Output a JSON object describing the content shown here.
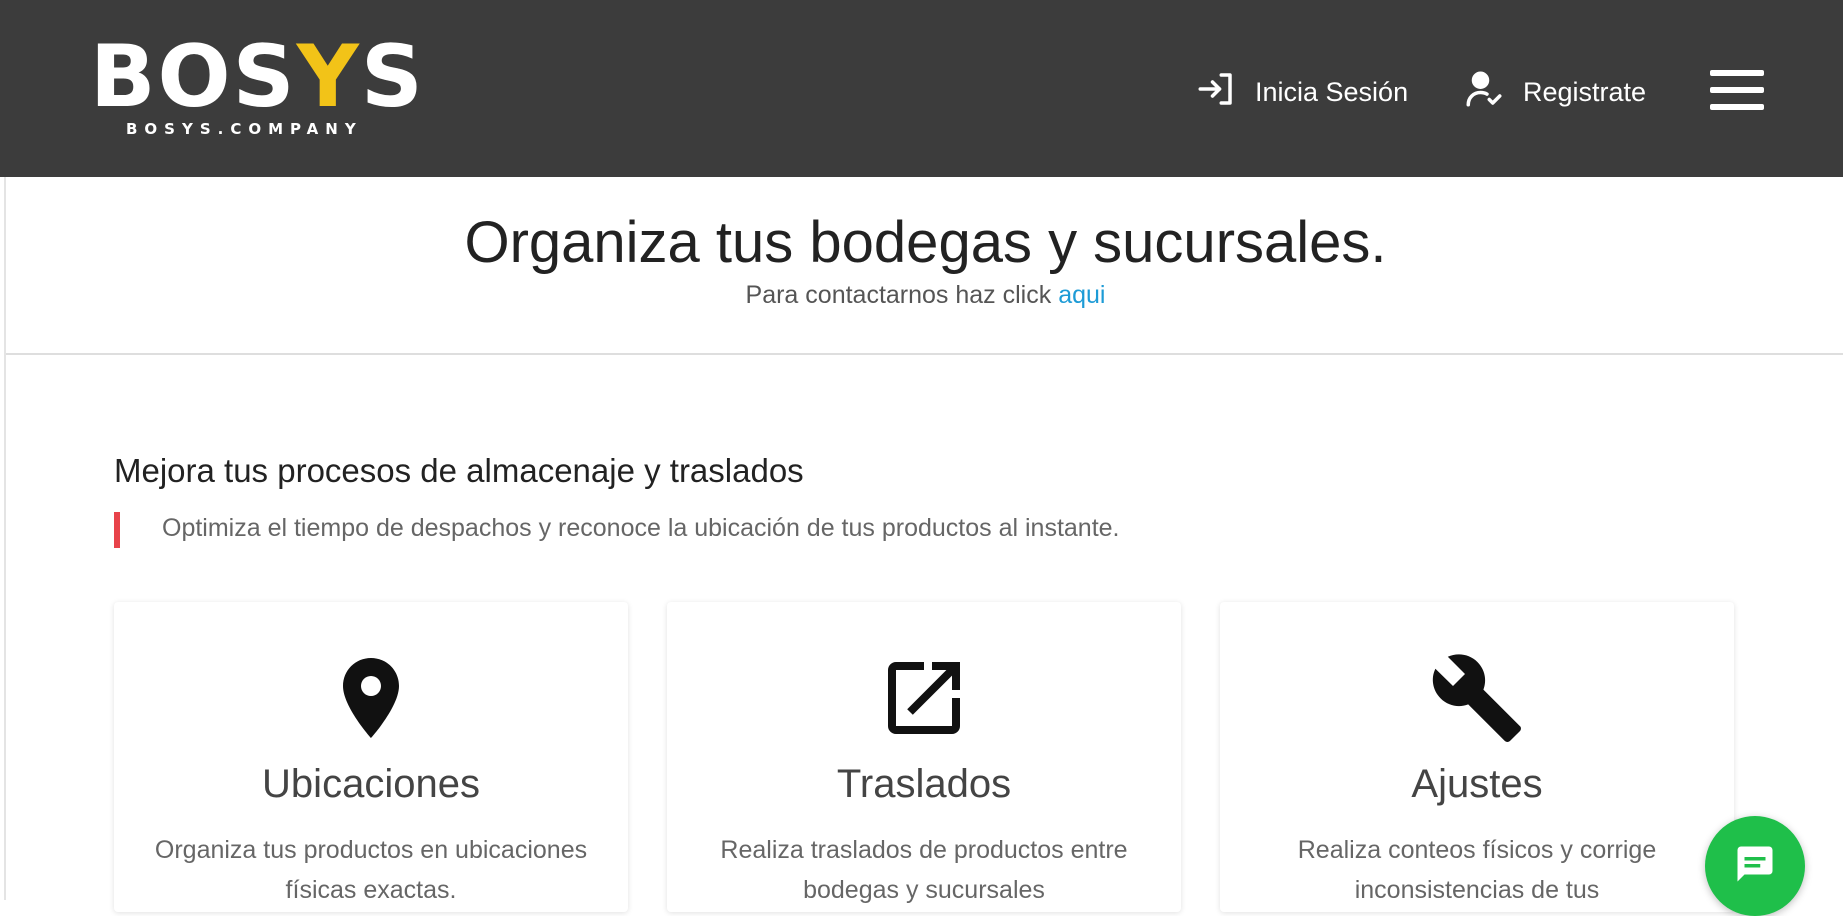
{
  "header": {
    "logo_text_start": "BOS",
    "logo_text_y": "Y",
    "logo_text_end": "S",
    "logo_subtitle": "BOSYS.COMPANY",
    "nav": {
      "login_label": "Inicia Sesión",
      "login_icon": "login-icon",
      "register_label": "Registrate",
      "register_icon": "user-check-icon"
    },
    "menu_icon": "hamburger-menu-icon"
  },
  "hero": {
    "title": "Organiza tus bodegas y sucursales.",
    "subtitle_text": "Para contactarnos haz click",
    "subtitle_link": "aqui"
  },
  "section": {
    "title": "Mejora tus procesos de almacenaje y traslados",
    "description": "Optimiza el tiempo de despachos y reconoce la ubicación de tus productos al instante."
  },
  "cards": [
    {
      "icon": "location-pin-icon",
      "title": "Ubicaciones",
      "text": "Organiza tus productos en ubicaciones físicas exactas."
    },
    {
      "icon": "open-external-icon",
      "title": "Traslados",
      "text": "Realiza traslados de productos entre bodegas y sucursales"
    },
    {
      "icon": "wrench-icon",
      "title": "Ajustes",
      "text": "Realiza conteos físicos y corrige inconsistencias de tus"
    }
  ],
  "chat": {
    "icon": "chat-icon"
  },
  "colors": {
    "header_bg": "#3c3c3c",
    "accent_yellow": "#f2c318",
    "link_blue": "#1d9bd6",
    "accent_red": "#e8434a",
    "chat_green": "#1fbf4a"
  }
}
